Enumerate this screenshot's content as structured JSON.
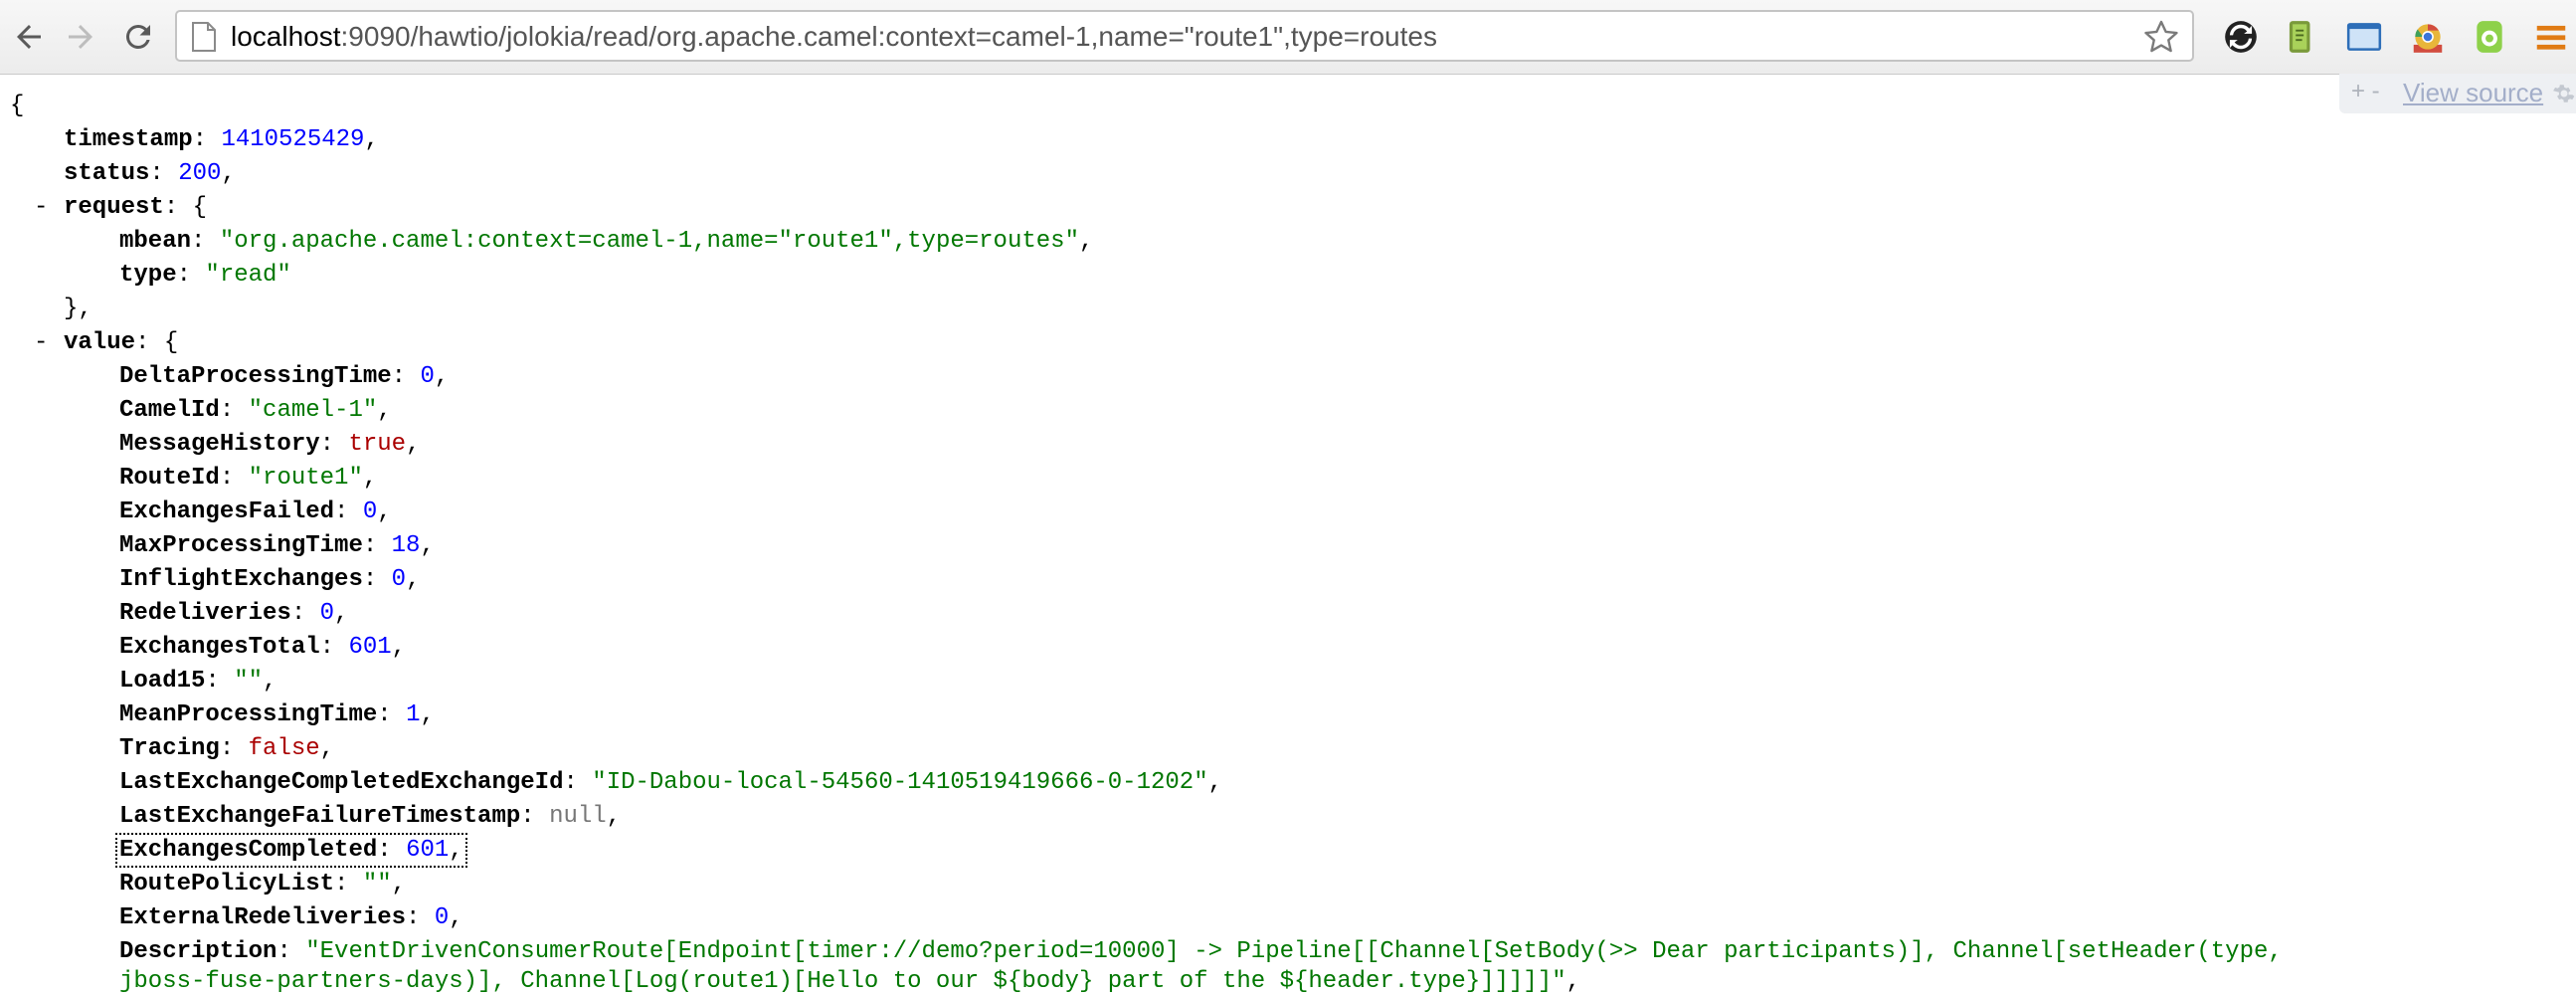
{
  "browser": {
    "url_host": "localhost",
    "url_path": ":9090/hawtio/jolokia/read/org.apache.camel:context=camel-1,name=\"route1\",type=routes",
    "icons": {
      "back": "back-arrow-icon",
      "forward": "forward-arrow-icon",
      "reload": "reload-icon",
      "page": "page-icon",
      "bookmark": "star-icon",
      "extensions": [
        "sync-icon",
        "evernote-icon",
        "window-resize-icon",
        "chrome-icon",
        "android-icon",
        "menu-icon"
      ]
    }
  },
  "view_source": {
    "collapse_label": "+ -",
    "link_label": "View source"
  },
  "json": {
    "open_brace": "{",
    "close_brace_comma": "},",
    "collapser_label": "-",
    "timestamp": {
      "key": "timestamp",
      "value": "1410525429"
    },
    "status": {
      "key": "status",
      "value": "200"
    },
    "request": {
      "key": "request",
      "mbean": {
        "key": "mbean",
        "value": "\"org.apache.camel:context=camel-1,name=\"route1\",type=routes\""
      },
      "type": {
        "key": "type",
        "value": "\"read\""
      }
    },
    "value": {
      "key": "value",
      "fields": [
        {
          "key": "DeltaProcessingTime",
          "value": "0",
          "type": "num"
        },
        {
          "key": "CamelId",
          "value": "\"camel-1\"",
          "type": "str"
        },
        {
          "key": "MessageHistory",
          "value": "true",
          "type": "boo"
        },
        {
          "key": "RouteId",
          "value": "\"route1\"",
          "type": "str"
        },
        {
          "key": "ExchangesFailed",
          "value": "0",
          "type": "num"
        },
        {
          "key": "MaxProcessingTime",
          "value": "18",
          "type": "num"
        },
        {
          "key": "InflightExchanges",
          "value": "0",
          "type": "num"
        },
        {
          "key": "Redeliveries",
          "value": "0",
          "type": "num"
        },
        {
          "key": "ExchangesTotal",
          "value": "601",
          "type": "num"
        },
        {
          "key": "Load15",
          "value": "\"\"",
          "type": "str"
        },
        {
          "key": "MeanProcessingTime",
          "value": "1",
          "type": "num"
        },
        {
          "key": "Tracing",
          "value": "false",
          "type": "boo"
        },
        {
          "key": "LastExchangeCompletedExchangeId",
          "value": "\"ID-Dabou-local-54560-1410519419666-0-1202\"",
          "type": "str"
        },
        {
          "key": "LastExchangeFailureTimestamp",
          "value": "null",
          "type": "nul"
        },
        {
          "key": "ExchangesCompleted",
          "value": "601",
          "type": "num"
        },
        {
          "key": "RoutePolicyList",
          "value": "\"\"",
          "type": "str"
        },
        {
          "key": "ExternalRedeliveries",
          "value": "0",
          "type": "num"
        }
      ],
      "description": {
        "key": "Description",
        "value_line1": "\"EventDrivenConsumerRoute[Endpoint[timer://demo?period=10000] -> Pipeline[[Channel[SetBody(>> Dear participants)], Channel[setHeader(type,",
        "value_line2": "jboss-fuse-partners-days)], Channel[Log(route1)[Hello to our ${body} part of the ${header.type}]]]]]\""
      }
    }
  }
}
